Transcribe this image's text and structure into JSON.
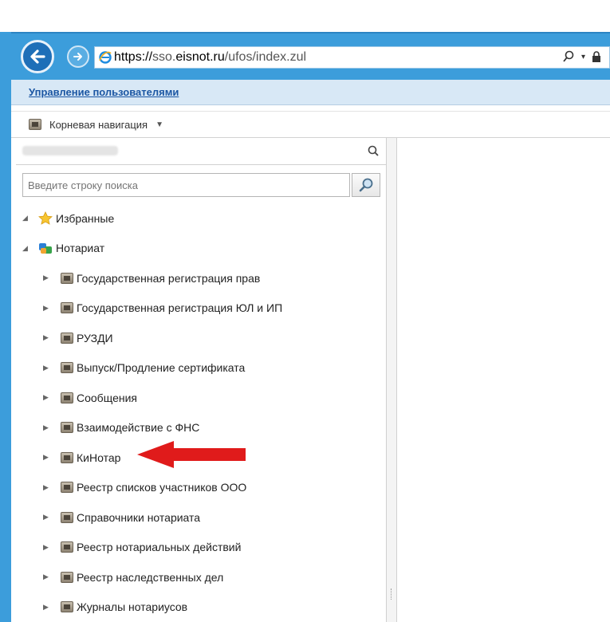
{
  "browser": {
    "url_proto": "https://",
    "url_host_prefix": "sso.",
    "url_host": "eisnot.ru",
    "url_path": "/ufos/index.zul"
  },
  "app": {
    "header_link": "Управление пользователями",
    "nav_label": "Корневая навигация"
  },
  "search": {
    "placeholder": "Введите строку поиска"
  },
  "tree": {
    "favorites": "Избранные",
    "notary": "Нотариат",
    "children": [
      "Государственная регистрация прав",
      "Государственная регистрация ЮЛ и ИП",
      "РУЗДИ",
      "Выпуск/Продление сертификата",
      "Сообщения",
      "Взаимодействие с ФНС",
      "КиНотар",
      "Реестр списков участников ООО",
      "Справочники нотариата",
      "Реестр нотариальных действий",
      "Реестр наследственных дел",
      "Журналы нотариусов"
    ]
  },
  "colors": {
    "browser_chrome": "#3c9ddb",
    "header_bg": "#d8e8f6",
    "link": "#1b56a3",
    "annotation_arrow": "#e01b1b"
  },
  "icons": {
    "back": "back-arrow-icon",
    "forward": "forward-arrow-icon",
    "browser": "internet-explorer-icon",
    "search": "magnifier-icon",
    "lock": "lock-icon",
    "folder": "folder-icon",
    "favorites": "star-icon",
    "notary": "notary-icon"
  }
}
